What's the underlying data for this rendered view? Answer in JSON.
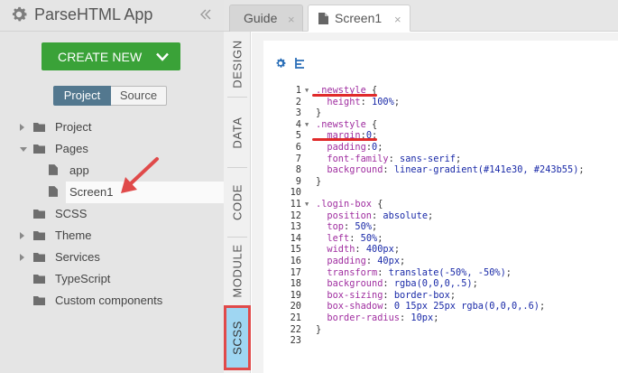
{
  "app": {
    "name": "ParseHTML App",
    "create_label": "CREATE NEW",
    "toggle": {
      "project": "Project",
      "source": "Source"
    }
  },
  "tree": [
    {
      "label": "Project",
      "caret": "right",
      "icon": "folder-icon"
    },
    {
      "label": "Pages",
      "caret": "down",
      "icon": "folder-icon"
    },
    {
      "label": "app",
      "caret": "",
      "icon": "page-icon"
    },
    {
      "label": "Screen1",
      "caret": "",
      "icon": "page-icon",
      "selected": true
    },
    {
      "label": "SCSS",
      "caret": "",
      "icon": "folder-icon"
    },
    {
      "label": "Theme",
      "caret": "right",
      "icon": "folder-icon"
    },
    {
      "label": "Services",
      "caret": "right",
      "icon": "folder-icon"
    },
    {
      "label": "TypeScript",
      "caret": "",
      "icon": "folder-icon"
    },
    {
      "label": "Custom components",
      "caret": "",
      "icon": "folder-icon"
    }
  ],
  "rail": {
    "design": "DESIGN",
    "data": "DATA",
    "code": "CODE",
    "module": "MODULE",
    "scss": "SCSS"
  },
  "tabs": {
    "guide": "Guide",
    "screen": "Screen1",
    "close": "×"
  },
  "code": {
    "lines": [
      {
        "n": "1",
        "fold": true,
        "text": ".newstyle {"
      },
      {
        "n": "2",
        "fold": false,
        "text": "  height: 100%;"
      },
      {
        "n": "3",
        "fold": false,
        "text": "}"
      },
      {
        "n": "4",
        "fold": true,
        "text": ".newstyle {"
      },
      {
        "n": "5",
        "fold": false,
        "text": "  margin:0;"
      },
      {
        "n": "6",
        "fold": false,
        "text": "  padding:0;"
      },
      {
        "n": "7",
        "fold": false,
        "text": "  font-family: sans-serif;"
      },
      {
        "n": "8",
        "fold": false,
        "text": "  background: linear-gradient(#141e30, #243b55);"
      },
      {
        "n": "9",
        "fold": false,
        "text": "}"
      },
      {
        "n": "10",
        "fold": false,
        "text": ""
      },
      {
        "n": "11",
        "fold": true,
        "text": ".login-box {"
      },
      {
        "n": "12",
        "fold": false,
        "text": "  position: absolute;"
      },
      {
        "n": "13",
        "fold": false,
        "text": "  top: 50%;"
      },
      {
        "n": "14",
        "fold": false,
        "text": "  left: 50%;"
      },
      {
        "n": "15",
        "fold": false,
        "text": "  width: 400px;"
      },
      {
        "n": "16",
        "fold": false,
        "text": "  padding: 40px;"
      },
      {
        "n": "17",
        "fold": false,
        "text": "  transform: translate(-50%, -50%);"
      },
      {
        "n": "18",
        "fold": false,
        "text": "  background: rgba(0,0,0,.5);"
      },
      {
        "n": "19",
        "fold": false,
        "text": "  box-sizing: border-box;"
      },
      {
        "n": "20",
        "fold": false,
        "text": "  box-shadow: 0 15px 25px rgba(0,0,0,.6);"
      },
      {
        "n": "21",
        "fold": false,
        "text": "  border-radius: 10px;"
      },
      {
        "n": "22",
        "fold": false,
        "text": "}"
      },
      {
        "n": "23",
        "fold": false,
        "text": ""
      }
    ]
  },
  "colors": {
    "create_button": "#3aa238",
    "toggle_active": "#53788f",
    "scss_tab_active": "#9fd6f2",
    "annotation_red": "#e02a2a"
  }
}
